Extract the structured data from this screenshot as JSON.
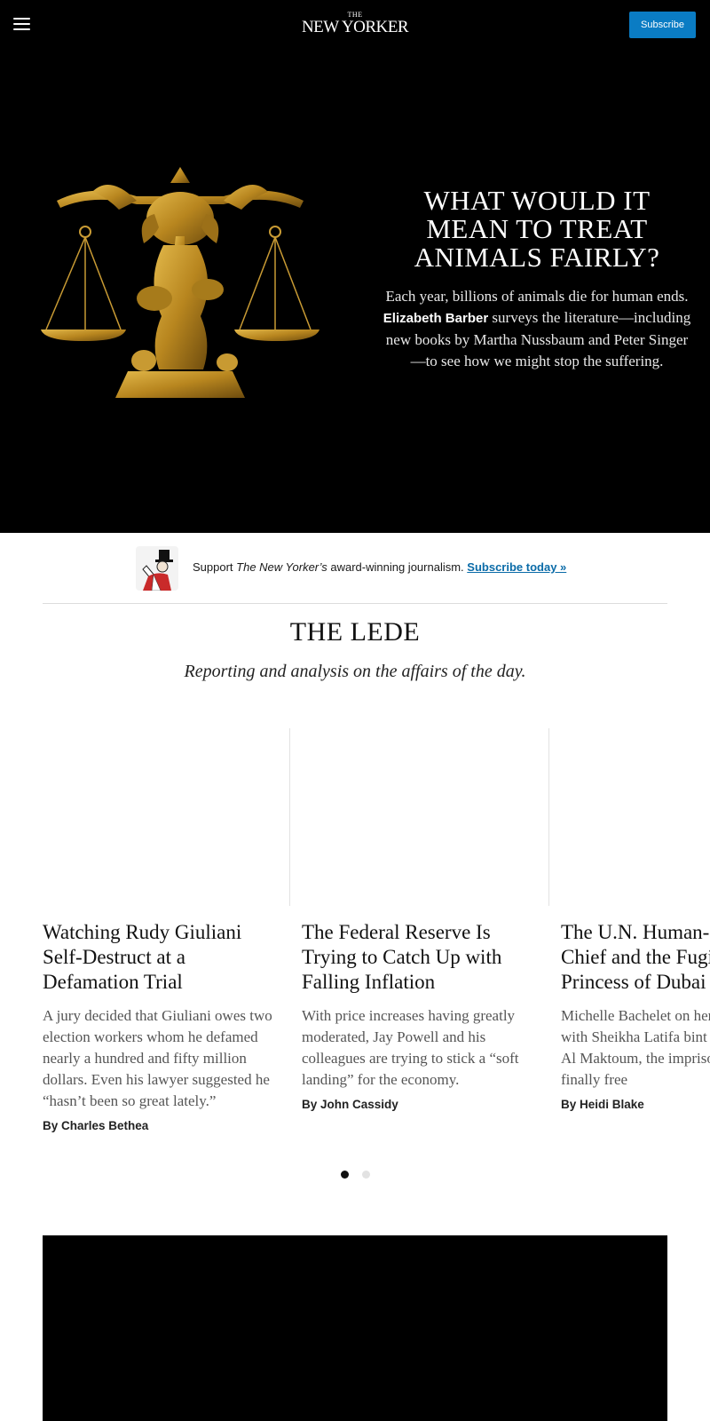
{
  "header": {
    "logo_small": "THE",
    "logo_name": "NEW YORKER",
    "subscribe_label": "Subscribe"
  },
  "hero": {
    "title": "WHAT WOULD IT MEAN TO TREAT ANIMALS FAIRLY?",
    "dek_before": "Each year, billions of animals die for human ends. ",
    "author": "Elizabeth Barber",
    "dek_after": " surveys the literature—including new books by Martha Nussbaum and Peter Singer—to see how we might stop the suffering."
  },
  "support": {
    "text_before": "Support ",
    "publication": "The New Yorker’s",
    "text_after": " award-winning journalism. ",
    "link": "Subscribe today »"
  },
  "section": {
    "title": "THE LEDE",
    "subtitle": "Reporting and analysis on the affairs of the day."
  },
  "cards": [
    {
      "title": "Watching Rudy Giuliani Self-Destruct at a Defamation Trial",
      "dek": "A jury decided that Giuliani owes two election workers whom he defamed nearly a hundred and fifty million dollars. Even his lawyer suggested he “hasn’t been so great lately.”",
      "byline": "By Charles Bethea"
    },
    {
      "title": "The Federal Reserve Is Trying to Catch Up with Falling Inflation",
      "dek": "With price increases having greatly moderated, Jay Powell and his colleagues are trying to stick a “soft landing” for the economy.",
      "byline": "By John Cassidy"
    },
    {
      "title": "The U.N. Human-Rights Chief and the Fugitive Princess of Dubai",
      "dek": "Michelle Bachelet on her meeting with Sheikha Latifa bint Mohammed Al Maktoum, the imprisoned royal finally free",
      "byline": "By Heidi Blake"
    }
  ],
  "carousel": {
    "active_page": 1,
    "page_count": 2
  },
  "colors": {
    "accent": "#0a7cc4",
    "link": "#0a6ba8",
    "hero_bg": "#000000"
  }
}
